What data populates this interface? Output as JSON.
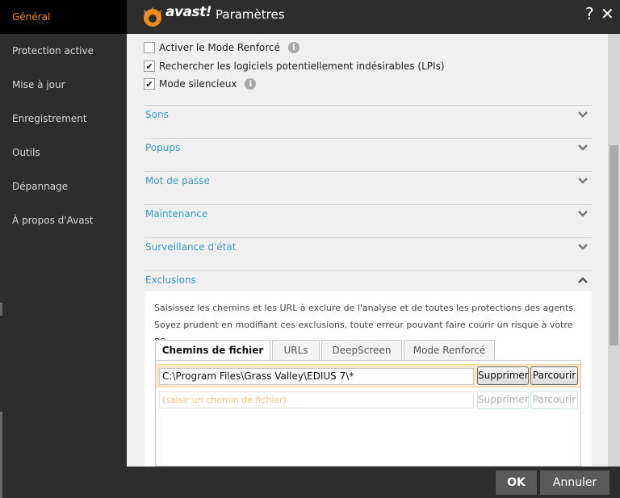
{
  "app": {
    "logo_text": "avast!",
    "title": "Paramètres",
    "help_label": "?",
    "close_label": "✕"
  },
  "sidebar": {
    "items": [
      {
        "label": "Général",
        "active": true
      },
      {
        "label": "Protection active"
      },
      {
        "label": "Mise à jour"
      },
      {
        "label": "Enregistrement"
      },
      {
        "label": "Outils"
      },
      {
        "label": "Dépannage"
      },
      {
        "label": "À propos d'Avast"
      }
    ]
  },
  "options": [
    {
      "label": "Activer le Mode Renforcé",
      "checked": false,
      "info": true
    },
    {
      "label": "Rechercher les logiciels potentiellement indésirables (LPIs)",
      "checked": true,
      "info": false
    },
    {
      "label": "Mode silencieux",
      "checked": true,
      "info": true
    }
  ],
  "sections": [
    {
      "label": "Sons",
      "expanded": false
    },
    {
      "label": "Popups",
      "expanded": false
    },
    {
      "label": "Mot de passe",
      "expanded": false
    },
    {
      "label": "Maintenance",
      "expanded": false
    },
    {
      "label": "Surveillance d'état",
      "expanded": false
    },
    {
      "label": "Exclusions",
      "expanded": true
    }
  ],
  "exclusions": {
    "description": "Saisissez les chemins et les URL à exclure de l'analyse et de toutes les protections des agents. Soyez prudent en modifiant ces exclusions, toute erreur pouvant faire courir un risque à votre PC.",
    "tabs": [
      {
        "label": "Chemins de fichier",
        "active": true
      },
      {
        "label": "URLs"
      },
      {
        "label": "DeepScreen"
      },
      {
        "label": "Mode Renforcé"
      }
    ],
    "rows": [
      {
        "value": "C:\\Program Files\\Grass Valley\\EDIUS 7\\*",
        "remove_label": "Supprimer",
        "browse_label": "Parcourir"
      },
      {
        "placeholder": "(saisir un chemin de fichier)",
        "remove_label": "Supprimer",
        "browse_label": "Parcourir"
      }
    ]
  },
  "footer": {
    "ok_label": "OK",
    "cancel_label": "Annuler"
  },
  "colors": {
    "accent": "#f08c1e",
    "link": "#3a9ec4",
    "dark": "#2d2d2d",
    "highlight_row": "#fbe8c6"
  }
}
